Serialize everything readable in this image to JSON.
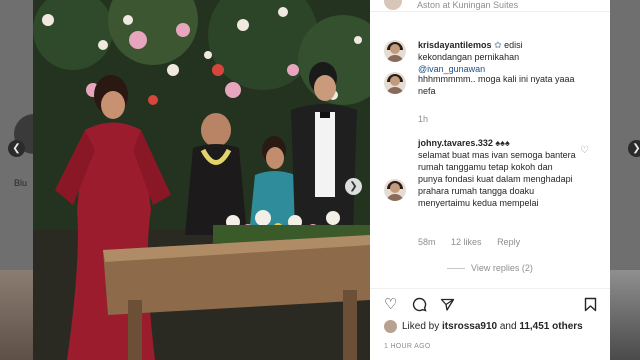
{
  "background": {
    "left_text": "Blu",
    "nav_left_icon": "chevron-left-icon",
    "nav_right_icon": "chevron-right-icon"
  },
  "post": {
    "image_icon": "photo",
    "carousel_next_icon": "chevron-right-icon"
  },
  "panel": {
    "top_location": "Aston at Kuningan Suites",
    "comments": [
      {
        "username": "krisdayantilemos",
        "text_line1": "edisi",
        "text_line2": "kekondangan pernikahan",
        "mention": "@ivan_gunawan"
      },
      {
        "text": "hhhmmmmm.. moga kali ini nyata yaaa nefa",
        "time": "1h"
      },
      {
        "username": "johny.tavares.332",
        "emoji": "♠♠♠",
        "text": "selamat buat mas ivan semoga bantera rumah tanggamu tetap kokoh dan punya fondasi kuat dalam menghadapi prahara rumah tangga doaku menyertaimu kedua mempelai",
        "time": "58m",
        "likes": "12 likes",
        "reply": "Reply"
      }
    ],
    "view_replies": "View replies (2)",
    "likes_by": "Liked by",
    "likes_user": "itsrossa910",
    "likes_and": "and",
    "likes_count": "11,451 others",
    "time_ago": "1 HOUR AGO",
    "icons": {
      "like": "heart-icon",
      "comment": "comment-icon",
      "share": "share-icon",
      "save": "bookmark-icon"
    }
  }
}
